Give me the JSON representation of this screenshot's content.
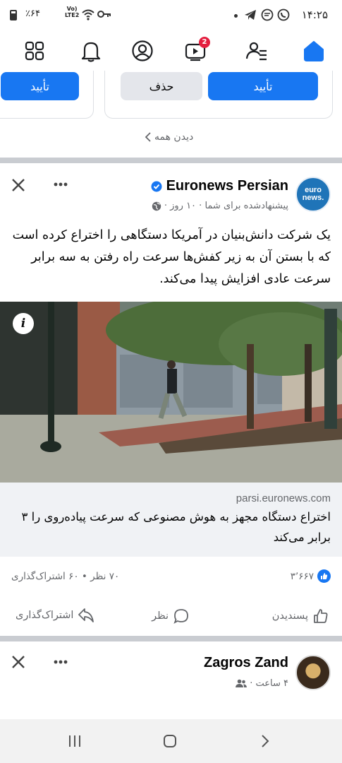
{
  "status_bar": {
    "time": "۱۴:۲۵",
    "battery": "٪۶۴",
    "network_top": "Vo)",
    "network_bottom": "LTE2"
  },
  "nav": {
    "items": [
      {
        "name": "menu",
        "icon": "grid-icon"
      },
      {
        "name": "notifications",
        "icon": "bell-icon"
      },
      {
        "name": "profile",
        "icon": "profile-icon"
      },
      {
        "name": "video",
        "icon": "video-icon",
        "badge": "2"
      },
      {
        "name": "friends",
        "icon": "friends-icon"
      },
      {
        "name": "home",
        "icon": "home-icon",
        "active": true
      }
    ],
    "accent": "#1877f2",
    "badge_color": "#e41e3f"
  },
  "suggestions": {
    "confirm_label": "تأیید",
    "delete_label": "حذف",
    "see_all": "دیدن همه"
  },
  "post": {
    "page_name": "Euronews Persian",
    "avatar_text_top": "euro",
    "avatar_text_bottom": "news.",
    "subline": "پیشنهادشده برای شما · ۱۰ روز ·",
    "text": "یک شرکت دانش‌بنیان در آمریکا دستگاهی را اختراع کرده است که با بستن آن به زیر کفش‌ها سرعت راه رفتن به سه برابر سرعت عادی افزایش پیدا می‌کند.",
    "info_icon_label": "i",
    "link_domain": "parsi.euronews.com",
    "link_title": "اختراع دستگاه مجهز به هوش مصنوعی که سرعت پیاده‌روی را ۳ برابر می‌کند",
    "reactions_count": "۳٬۶۶۷",
    "comments_shares": "۷۰ نظر • ۶۰ اشتراک‌گذاری",
    "like_label": "پسندیدن",
    "comment_label": "نظر",
    "share_label": "اشتراک‌گذاری"
  },
  "post2": {
    "author": "Zagros Zand",
    "subline": "۴ ساعت ·"
  }
}
